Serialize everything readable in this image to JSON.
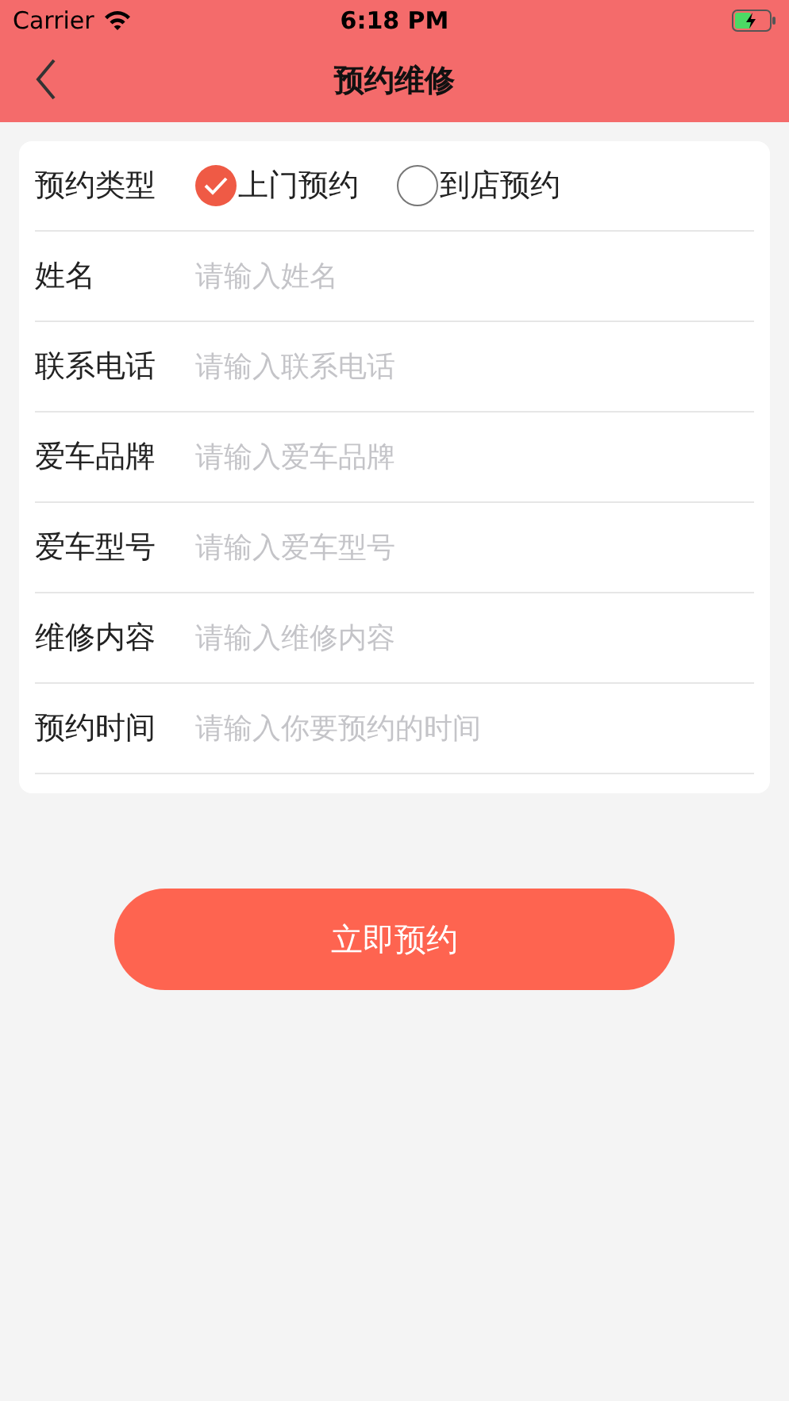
{
  "status_bar": {
    "carrier": "Carrier",
    "time": "6:18 PM"
  },
  "nav": {
    "title": "预约维修"
  },
  "form": {
    "type_row": {
      "label": "预约类型",
      "options": [
        {
          "label": "上门预约",
          "selected": true
        },
        {
          "label": "到店预约",
          "selected": false
        }
      ]
    },
    "fields": [
      {
        "label": "姓名",
        "placeholder": "请输入姓名"
      },
      {
        "label": "联系电话",
        "placeholder": "请输入联系电话"
      },
      {
        "label": "爱车品牌",
        "placeholder": "请输入爱车品牌"
      },
      {
        "label": "爱车型号",
        "placeholder": "请输入爱车型号"
      },
      {
        "label": "维修内容",
        "placeholder": "请输入维修内容"
      },
      {
        "label": "预约时间",
        "placeholder": "请输入你要预约的时间"
      }
    ]
  },
  "submit": "立即预约"
}
